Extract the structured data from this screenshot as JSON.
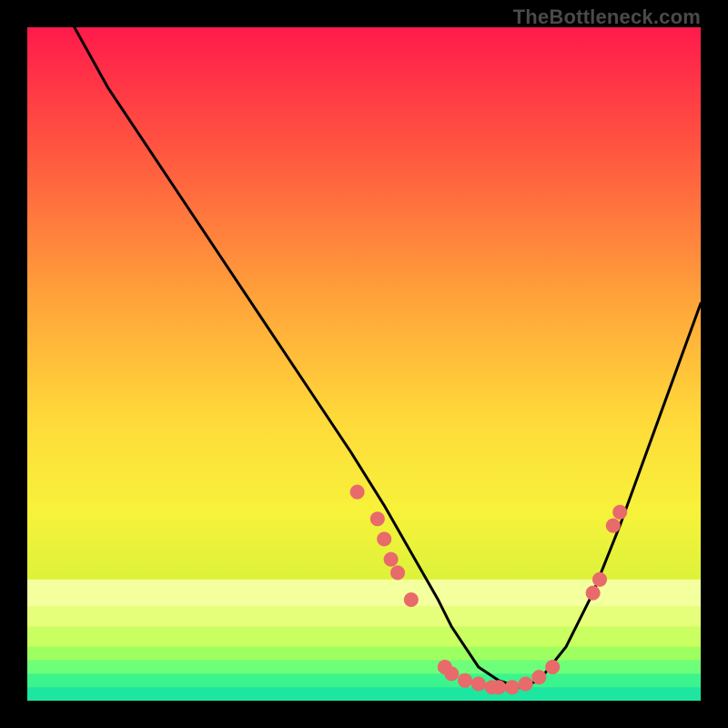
{
  "watermark": "TheBottleneck.com",
  "chart_data": {
    "type": "line",
    "title": "",
    "xlabel": "",
    "ylabel": "",
    "xlim": [
      0,
      100
    ],
    "ylim": [
      0,
      100
    ],
    "grid": false,
    "background_gradient": {
      "stops": [
        {
          "offset": 0,
          "color": "#ff1a4b"
        },
        {
          "offset": 18,
          "color": "#ff5540"
        },
        {
          "offset": 40,
          "color": "#ffa23a"
        },
        {
          "offset": 58,
          "color": "#ffd93a"
        },
        {
          "offset": 72,
          "color": "#f7f23a"
        },
        {
          "offset": 84,
          "color": "#d8f23a"
        },
        {
          "offset": 92,
          "color": "#9ef23a"
        },
        {
          "offset": 100,
          "color": "#39f47a"
        }
      ]
    },
    "bottom_bands": [
      {
        "y_from": 82,
        "y_to": 86,
        "color": "#f4ff9e"
      },
      {
        "y_from": 86,
        "y_to": 89,
        "color": "#e6ff7a"
      },
      {
        "y_from": 89,
        "y_to": 92,
        "color": "#c9ff60"
      },
      {
        "y_from": 92,
        "y_to": 94,
        "color": "#9dff60"
      },
      {
        "y_from": 94,
        "y_to": 96,
        "color": "#6dff7a"
      },
      {
        "y_from": 96,
        "y_to": 98,
        "color": "#3cf48d"
      },
      {
        "y_from": 98,
        "y_to": 100,
        "color": "#1de6a0"
      }
    ],
    "series": [
      {
        "name": "bottleneck-curve",
        "color": "#000000",
        "x": [
          7,
          12,
          18,
          24,
          30,
          36,
          42,
          48,
          53,
          57,
          61,
          63,
          65,
          67,
          70,
          73,
          76,
          80,
          84,
          88,
          92,
          96,
          100
        ],
        "y": [
          100,
          91,
          82,
          73,
          64,
          55,
          46,
          37,
          29,
          22,
          15,
          11,
          8,
          5,
          3,
          2,
          3,
          8,
          16,
          26,
          37,
          48,
          59
        ]
      }
    ],
    "points": {
      "name": "data-points",
      "color": "#e86a6a",
      "radius": 8,
      "xy": [
        [
          49,
          31
        ],
        [
          52,
          27
        ],
        [
          53,
          24
        ],
        [
          54,
          21
        ],
        [
          55,
          19
        ],
        [
          57,
          15
        ],
        [
          62,
          5
        ],
        [
          63,
          4
        ],
        [
          65,
          3
        ],
        [
          67,
          2.5
        ],
        [
          69,
          2
        ],
        [
          70,
          2
        ],
        [
          72,
          2
        ],
        [
          74,
          2.5
        ],
        [
          76,
          3.5
        ],
        [
          78,
          5
        ],
        [
          84,
          16
        ],
        [
          85,
          18
        ],
        [
          87,
          26
        ],
        [
          88,
          28
        ]
      ]
    }
  }
}
